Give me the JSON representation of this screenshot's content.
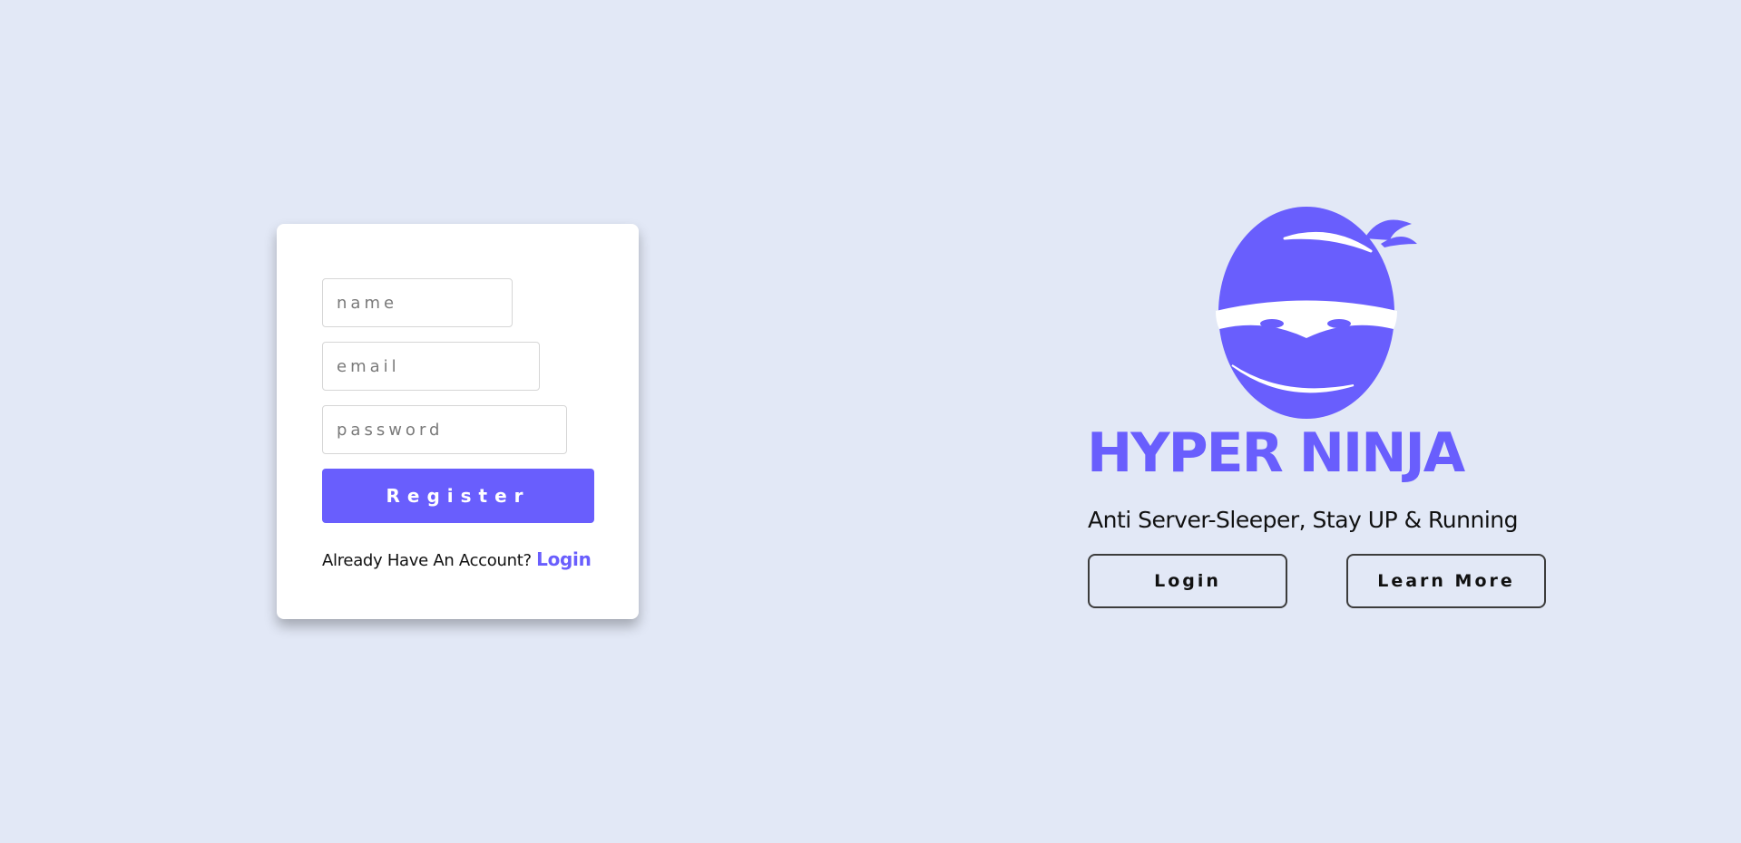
{
  "register_form": {
    "name_placeholder": "name",
    "email_placeholder": "email",
    "password_placeholder": "password",
    "register_label": "Register",
    "account_prompt": "Already Have An Account?",
    "login_link": "Login"
  },
  "hero": {
    "logo_icon": "ninja-head-icon",
    "title": "HYPER NINJA",
    "subtitle": "Anti Server-Sleeper,  Stay UP & Running",
    "login_label": "Login",
    "learn_more_label": "Learn More"
  },
  "colors": {
    "background": "#e2e8f6",
    "accent": "#695efd",
    "card": "#ffffff"
  }
}
